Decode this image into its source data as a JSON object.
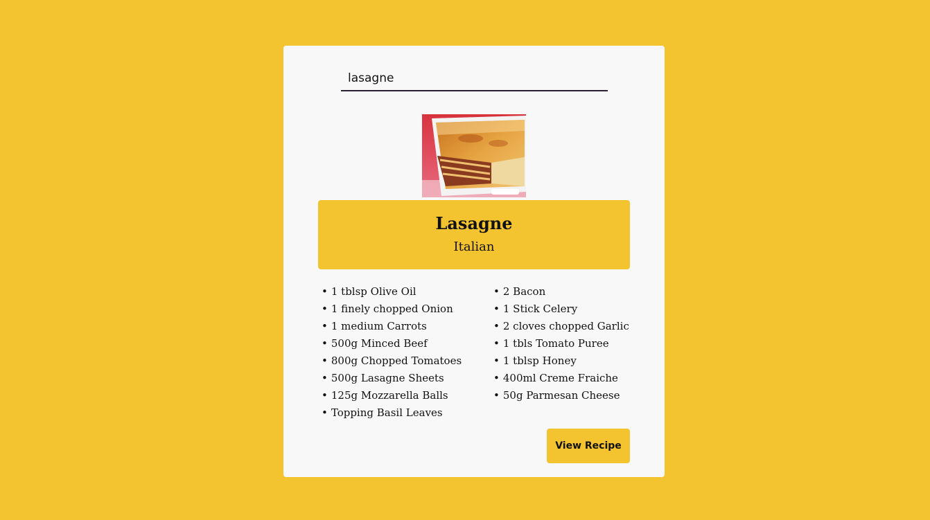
{
  "search": {
    "value": "lasagne"
  },
  "meal": {
    "name": "Lasagne",
    "area": "Italian"
  },
  "ingredients": [
    "1 tblsp Olive Oil",
    "2 Bacon",
    "1 finely chopped Onion",
    "1 Stick Celery",
    "1 medium Carrots",
    "2 cloves chopped Garlic",
    "500g Minced Beef",
    "1 tbls Tomato Puree",
    "800g Chopped Tomatoes",
    "1 tblsp Honey",
    "500g Lasagne Sheets",
    "400ml Creme Fraiche",
    "125g Mozzarella Balls",
    "50g Parmesan Cheese",
    "Topping Basil Leaves"
  ],
  "actions": {
    "view_recipe_label": "View Recipe"
  },
  "colors": {
    "background": "#f4c430",
    "card": "#f8f8f8",
    "accent": "#f4c430",
    "search_underline": "#2a1e33"
  }
}
